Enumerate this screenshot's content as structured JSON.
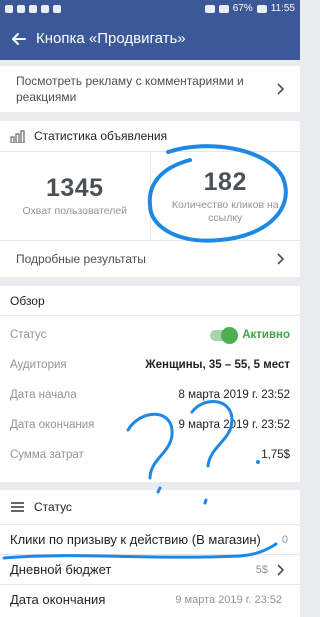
{
  "status_bar": {
    "battery": "67%",
    "time": "11:55"
  },
  "app_bar": {
    "title": "Кнопка «Продвигать»"
  },
  "comments_link": {
    "label": "Посмотреть рекламу с комментариями и реакциями"
  },
  "ad_stats": {
    "title": "Статистика объявления",
    "reach": {
      "value": "1345",
      "label": "Охват пользователей"
    },
    "clicks": {
      "value": "182",
      "label": "Количество кликов на ссылку"
    },
    "details_label": "Подробные результаты"
  },
  "overview": {
    "title": "Обзор",
    "rows": [
      {
        "key": "Статус",
        "value": "Активно"
      },
      {
        "key": "Аудитория",
        "value": "Женщины, 35 – 55, 5 мест"
      },
      {
        "key": "Дата начала",
        "value": "8 марта 2019 г. 23:52"
      },
      {
        "key": "Дата окончания",
        "value": "9 марта 2019 г. 23:52"
      },
      {
        "key": "Сумма затрат",
        "value": "1,75$"
      }
    ]
  },
  "status_section": {
    "title": "Статус",
    "rows": [
      {
        "label": "Клики по призыву к действию (В магазин)",
        "value": "0"
      },
      {
        "label": "Дневной бюджет",
        "value": "5$"
      },
      {
        "label": "Дата окончания",
        "value": "9 марта 2019 г. 23:52"
      }
    ]
  },
  "colors": {
    "brand": "#3b5998",
    "active": "#43a047",
    "scribble": "#1e88e5"
  }
}
